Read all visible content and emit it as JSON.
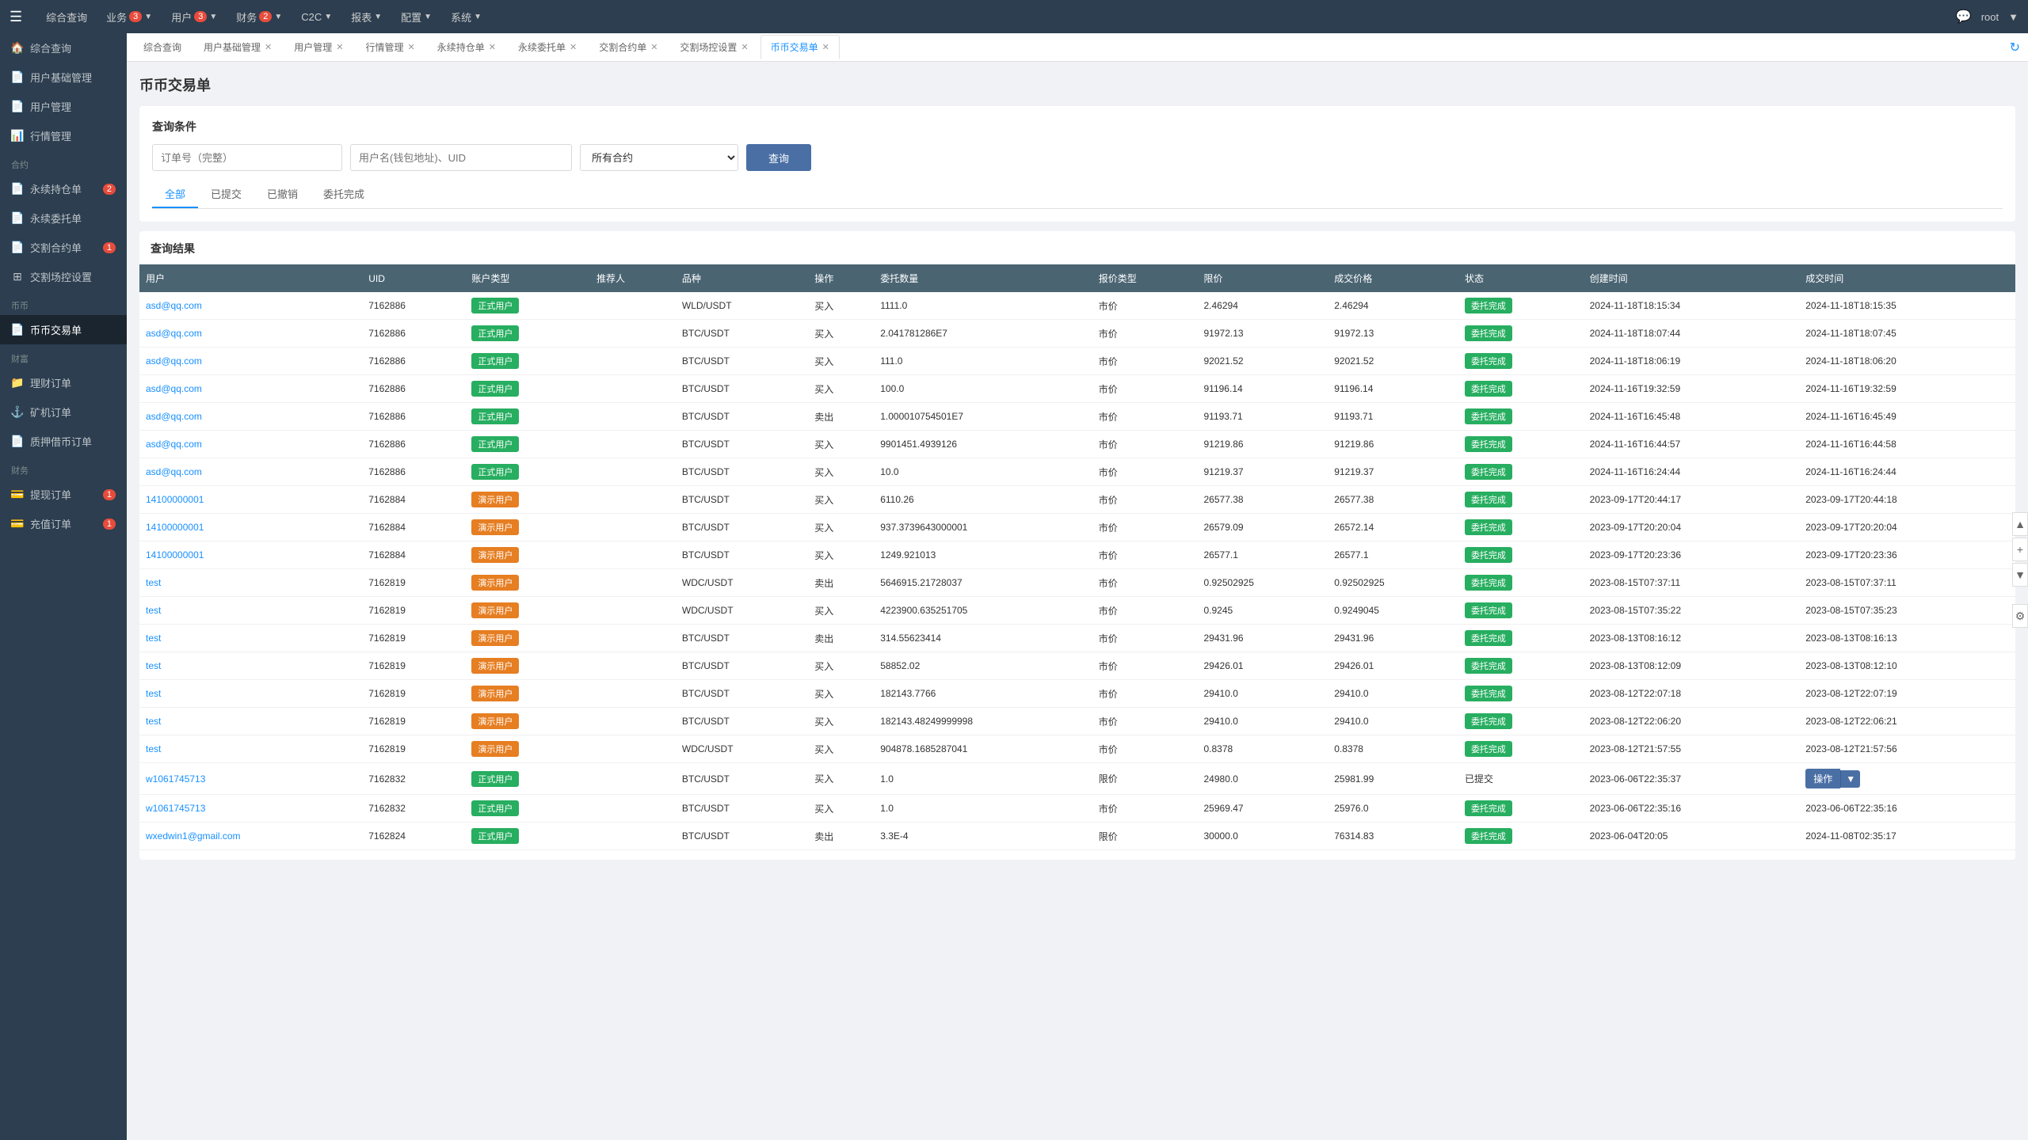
{
  "topNav": {
    "hamburger": "☰",
    "items": [
      {
        "label": "综合查询",
        "badge": null
      },
      {
        "label": "业务",
        "badge": "3"
      },
      {
        "label": "用户",
        "badge": "3"
      },
      {
        "label": "财务",
        "badge": "2"
      },
      {
        "label": "C2C",
        "badge": null
      },
      {
        "label": "报表",
        "badge": null
      },
      {
        "label": "配置",
        "badge": null
      },
      {
        "label": "系统",
        "badge": null
      }
    ],
    "user": "root"
  },
  "sidebar": {
    "topItems": [
      {
        "label": "综合查询",
        "icon": "🏠",
        "active": false
      },
      {
        "label": "用户基础管理",
        "icon": "📄",
        "active": false
      },
      {
        "label": "用户管理",
        "icon": "📄",
        "active": false
      },
      {
        "label": "行情管理",
        "icon": "📊",
        "active": false
      }
    ],
    "sections": [
      {
        "label": "合约",
        "items": [
          {
            "label": "永续持仓单",
            "icon": "📄",
            "badge": "2",
            "active": false
          },
          {
            "label": "永续委托单",
            "icon": "📄",
            "badge": null,
            "active": false
          },
          {
            "label": "交割合约单",
            "icon": "📄",
            "badge": "1",
            "active": false
          },
          {
            "label": "交割场控设置",
            "icon": "⊞",
            "badge": null,
            "active": false
          }
        ]
      },
      {
        "label": "币币",
        "items": [
          {
            "label": "币币交易单",
            "icon": "📄",
            "badge": null,
            "active": true
          }
        ]
      },
      {
        "label": "财富",
        "items": [
          {
            "label": "理财订单",
            "icon": "📁",
            "badge": null,
            "active": false
          },
          {
            "label": "矿机订单",
            "icon": "⚓",
            "badge": null,
            "active": false
          },
          {
            "label": "质押借币订单",
            "icon": "📄",
            "badge": null,
            "active": false
          }
        ]
      },
      {
        "label": "财务",
        "items": [
          {
            "label": "提现订单",
            "icon": "💳",
            "badge": "1",
            "active": false
          },
          {
            "label": "充值订单",
            "icon": "💳",
            "badge": "1",
            "active": false
          }
        ]
      }
    ]
  },
  "tabs": [
    {
      "label": "综合查询",
      "closable": false,
      "active": false
    },
    {
      "label": "用户基础管理",
      "closable": true,
      "active": false
    },
    {
      "label": "用户管理",
      "closable": true,
      "active": false
    },
    {
      "label": "行情管理",
      "closable": true,
      "active": false
    },
    {
      "label": "永续持仓单",
      "closable": true,
      "active": false
    },
    {
      "label": "永续委托单",
      "closable": true,
      "active": false
    },
    {
      "label": "交割合约单",
      "closable": true,
      "active": false
    },
    {
      "label": "交割场控设置",
      "closable": true,
      "active": false
    },
    {
      "label": "币币交易单",
      "closable": true,
      "active": true
    }
  ],
  "page": {
    "title": "币币交易单",
    "querySection": {
      "title": "查询条件",
      "orderPlaceholder": "订单号（完整）",
      "userPlaceholder": "用户名(钱包地址)、UID",
      "contractDefault": "所有合约",
      "queryBtn": "查询"
    },
    "filterTabs": [
      "全部",
      "已提交",
      "已撤销",
      "委托完成"
    ],
    "activeFilter": "全部",
    "resultsTitle": "查询结果",
    "tableHeaders": [
      "用户",
      "UID",
      "账户类型",
      "推荐人",
      "品种",
      "操作",
      "委托数量",
      "报价类型",
      "限价",
      "成交价格",
      "状态",
      "创建时间",
      "成交时间"
    ],
    "tableRows": [
      {
        "user": "asd@qq.com",
        "uid": "7162886",
        "accountType": "正式用户",
        "accountTypeBadge": "green",
        "referrer": "",
        "product": "WLD/USDT",
        "action": "买入",
        "quantity": "1111.0",
        "quoteType": "市价",
        "limitPrice": "2.46294",
        "dealPrice": "2.46294",
        "status": "委托完成",
        "statusBadge": "green",
        "createTime": "2024-11-18T18:15:34",
        "dealTime": "2024-11-18T18:15:35"
      },
      {
        "user": "asd@qq.com",
        "uid": "7162886",
        "accountType": "正式用户",
        "accountTypeBadge": "green",
        "referrer": "",
        "product": "BTC/USDT",
        "action": "买入",
        "quantity": "2.04178128​6E7",
        "quoteType": "市价",
        "limitPrice": "91972.13",
        "dealPrice": "91972.13",
        "status": "委托完成",
        "statusBadge": "green",
        "createTime": "2024-11-18T18:07:44",
        "dealTime": "2024-11-18T18:07:45"
      },
      {
        "user": "asd@qq.com",
        "uid": "7162886",
        "accountType": "正式用户",
        "accountTypeBadge": "green",
        "referrer": "",
        "product": "BTC/USDT",
        "action": "买入",
        "quantity": "111.0",
        "quoteType": "市价",
        "limitPrice": "92021.52",
        "dealPrice": "92021.52",
        "status": "委托完成",
        "statusBadge": "green",
        "createTime": "2024-11-18T18:06:19",
        "dealTime": "2024-11-18T18:06:20"
      },
      {
        "user": "asd@qq.com",
        "uid": "7162886",
        "accountType": "正式用户",
        "accountTypeBadge": "green",
        "referrer": "",
        "product": "BTC/USDT",
        "action": "买入",
        "quantity": "100.0",
        "quoteType": "市价",
        "limitPrice": "91196.14",
        "dealPrice": "91196.14",
        "status": "委托完成",
        "statusBadge": "green",
        "createTime": "2024-11-16T19:32:59",
        "dealTime": "2024-11-16T19:32:59"
      },
      {
        "user": "asd@qq.com",
        "uid": "7162886",
        "accountType": "正式用户",
        "accountTypeBadge": "green",
        "referrer": "",
        "product": "BTC/USDT",
        "action": "卖出",
        "quantity": "1.000010754501E7",
        "quoteType": "市价",
        "limitPrice": "91193.71",
        "dealPrice": "91193.71",
        "status": "委托完成",
        "statusBadge": "green",
        "createTime": "2024-11-16T16:45:48",
        "dealTime": "2024-11-16T16:45:49"
      },
      {
        "user": "asd@qq.com",
        "uid": "7162886",
        "accountType": "正式用户",
        "accountTypeBadge": "green",
        "referrer": "",
        "product": "BTC/USDT",
        "action": "买入",
        "quantity": "9901451.4939126",
        "quoteType": "市价",
        "limitPrice": "91219.86",
        "dealPrice": "91219.86",
        "status": "委托完成",
        "statusBadge": "green",
        "createTime": "2024-11-16T16:44:57",
        "dealTime": "2024-11-16T16:44:58"
      },
      {
        "user": "asd@qq.com",
        "uid": "7162886",
        "accountType": "正式用户",
        "accountTypeBadge": "green",
        "referrer": "",
        "product": "BTC/USDT",
        "action": "买入",
        "quantity": "10.0",
        "quoteType": "市价",
        "limitPrice": "91219.37",
        "dealPrice": "91219.37",
        "status": "委托完成",
        "statusBadge": "green",
        "createTime": "2024-11-16T16:24:44",
        "dealTime": "2024-11-16T16:24:44"
      },
      {
        "user": "14100000001",
        "uid": "7162884",
        "accountType": "演示用户",
        "accountTypeBadge": "orange",
        "referrer": "",
        "product": "BTC/USDT",
        "action": "买入",
        "quantity": "6110.26",
        "quoteType": "市价",
        "limitPrice": "26577.38",
        "dealPrice": "26577.38",
        "status": "委托完成",
        "statusBadge": "green",
        "createTime": "2023-09-17T20:44:17",
        "dealTime": "2023-09-17T20:44:18"
      },
      {
        "user": "14100000001",
        "uid": "7162884",
        "accountType": "演示用户",
        "accountTypeBadge": "orange",
        "referrer": "",
        "product": "BTC/USDT",
        "action": "买入",
        "quantity": "937.3739643000001",
        "quoteType": "市价",
        "limitPrice": "26579.09",
        "dealPrice": "26572.14",
        "status": "委托完成",
        "statusBadge": "green",
        "createTime": "2023-09-17T20:20:04",
        "dealTime": "2023-09-17T20:20:04"
      },
      {
        "user": "14100000001",
        "uid": "7162884",
        "accountType": "演示用户",
        "accountTypeBadge": "orange",
        "referrer": "",
        "product": "BTC/USDT",
        "action": "买入",
        "quantity": "1249.921013",
        "quoteType": "市价",
        "limitPrice": "26577.1",
        "dealPrice": "26577.1",
        "status": "委托完成",
        "statusBadge": "green",
        "createTime": "2023-09-17T20:23:36",
        "dealTime": "2023-09-17T20:23:36"
      },
      {
        "user": "test",
        "uid": "7162819",
        "accountType": "演示用户",
        "accountTypeBadge": "orange",
        "referrer": "",
        "product": "WDC/USDT",
        "action": "卖出",
        "quantity": "5646915.21728037",
        "quoteType": "市价",
        "limitPrice": "0.92502925",
        "dealPrice": "0.92502925",
        "status": "委托完成",
        "statusBadge": "green",
        "createTime": "2023-08-15T07:37:11",
        "dealTime": "2023-08-15T07:37:11"
      },
      {
        "user": "test",
        "uid": "7162819",
        "accountType": "演示用户",
        "accountTypeBadge": "orange",
        "referrer": "",
        "product": "WDC/USDT",
        "action": "买入",
        "quantity": "4223900.635251705",
        "quoteType": "市价",
        "limitPrice": "0.9245",
        "dealPrice": "0.9249045",
        "status": "委托完成",
        "statusBadge": "green",
        "createTime": "2023-08-15T07:35:22",
        "dealTime": "2023-08-15T07:35:23"
      },
      {
        "user": "test",
        "uid": "7162819",
        "accountType": "演示用户",
        "accountTypeBadge": "orange",
        "referrer": "",
        "product": "BTC/USDT",
        "action": "卖出",
        "quantity": "314.55623414",
        "quoteType": "市价",
        "limitPrice": "29431.96",
        "dealPrice": "29431.96",
        "status": "委托完成",
        "statusBadge": "green",
        "createTime": "2023-08-13T08:16:12",
        "dealTime": "2023-08-13T08:16:13"
      },
      {
        "user": "test",
        "uid": "7162819",
        "accountType": "演示用户",
        "accountTypeBadge": "orange",
        "referrer": "",
        "product": "BTC/USDT",
        "action": "买入",
        "quantity": "58852.02",
        "quoteType": "市价",
        "limitPrice": "29426.01",
        "dealPrice": "29426.01",
        "status": "委托完成",
        "statusBadge": "green",
        "createTime": "2023-08-13T08:12:09",
        "dealTime": "2023-08-13T08:12:10"
      },
      {
        "user": "test",
        "uid": "7162819",
        "accountType": "演示用户",
        "accountTypeBadge": "orange",
        "referrer": "",
        "product": "BTC/USDT",
        "action": "买入",
        "quantity": "182143.7766",
        "quoteType": "市价",
        "limitPrice": "29410.0",
        "dealPrice": "29410.0",
        "status": "委托完成",
        "statusBadge": "green",
        "createTime": "2023-08-12T22:07:18",
        "dealTime": "2023-08-12T22:07:19"
      },
      {
        "user": "test",
        "uid": "7162819",
        "accountType": "演示用户",
        "accountTypeBadge": "orange",
        "referrer": "",
        "product": "BTC/USDT",
        "action": "买入",
        "quantity": "182143.48249999998",
        "quoteType": "市价",
        "limitPrice": "29410.0",
        "dealPrice": "29410.0",
        "status": "委托完成",
        "statusBadge": "green",
        "createTime": "2023-08-12T22:06:20",
        "dealTime": "2023-08-12T22:06:21"
      },
      {
        "user": "test",
        "uid": "7162819",
        "accountType": "演示用户",
        "accountTypeBadge": "orange",
        "referrer": "",
        "product": "WDC/USDT",
        "action": "买入",
        "quantity": "904878.1685287041",
        "quoteType": "市价",
        "limitPrice": "0.8378",
        "dealPrice": "0.8378",
        "status": "委托完成",
        "statusBadge": "green",
        "createTime": "2023-08-12T21:57:55",
        "dealTime": "2023-08-12T21:57:56"
      },
      {
        "user": "w1061745713",
        "uid": "7162832",
        "accountType": "正式用户",
        "accountTypeBadge": "green",
        "referrer": "",
        "product": "BTC/USDT",
        "action": "买入",
        "quantity": "1.0",
        "quoteType": "限价",
        "limitPrice": "24980.0",
        "dealPrice": "25981.99",
        "status": "已提交",
        "statusBadge": "blue",
        "createTime": "2023-06-06T22:35:37",
        "dealTime": "",
        "hasOp": true
      },
      {
        "user": "w1061745713",
        "uid": "7162832",
        "accountType": "正式用户",
        "accountTypeBadge": "green",
        "referrer": "",
        "product": "BTC/USDT",
        "action": "买入",
        "quantity": "1.0",
        "quoteType": "市价",
        "limitPrice": "25969.47",
        "dealPrice": "25976.0",
        "status": "委托完成",
        "statusBadge": "green",
        "createTime": "2023-06-06T22:35:16",
        "dealTime": "2023-06-06T22:35:16"
      },
      {
        "user": "wxedwin1@gmail.com",
        "uid": "7162824",
        "accountType": "正式用户",
        "accountTypeBadge": "green",
        "referrer": "",
        "product": "BTC/USDT",
        "action": "卖出",
        "quantity": "3.3E-4",
        "quoteType": "限价",
        "limitPrice": "30000.0",
        "dealPrice": "76314.83",
        "status": "委托完成",
        "statusBadge": "green",
        "createTime": "2023-06-04T20:05",
        "dealTime": "2024-11-08T02:35:17"
      }
    ],
    "opBtn": "操作"
  }
}
